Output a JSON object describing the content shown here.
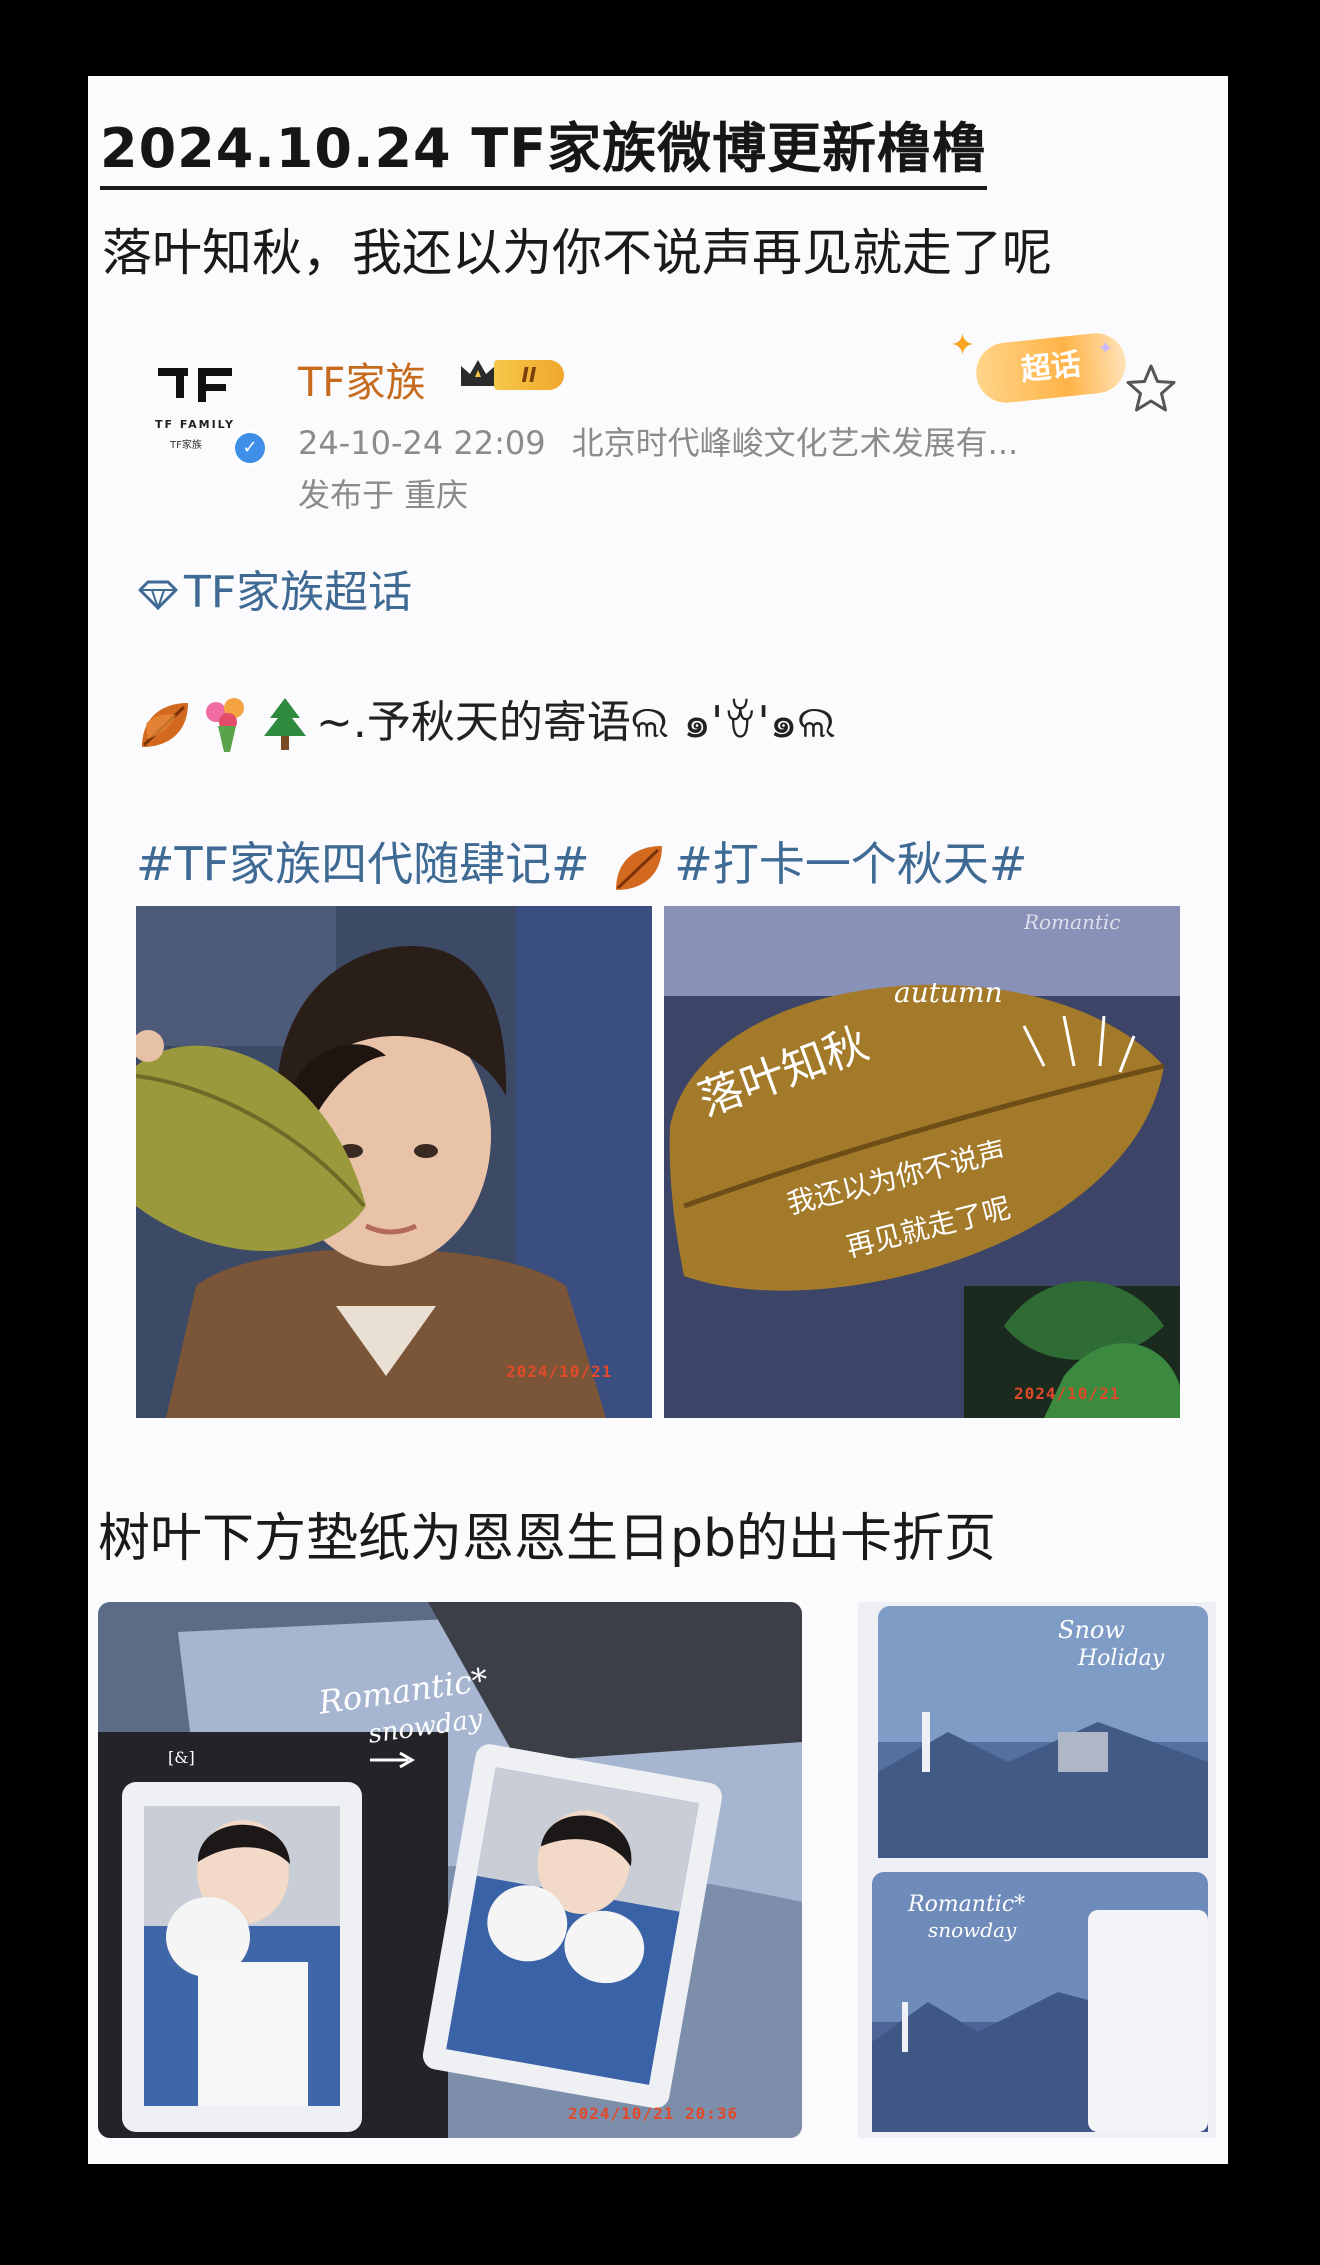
{
  "header": {
    "title": "2024.10.24  TF家族微博更新橹橹",
    "subtitle": "落叶知秋，我还以为你不说声再见就走了呢"
  },
  "post": {
    "logo_text": "TF FAMILY",
    "logo_subtext": "TF家族",
    "username": "TF家族",
    "level": "II",
    "timestamp": "24-10-24 22:09",
    "source": "北京时代峰峻文化艺术发展有...",
    "location": "发布于 重庆",
    "supertopic_badge": "超话",
    "topic_link": "TF家族超话",
    "body_text": "~.予秋天的寄语ଲ ๑'ꈊ'๑ଲ",
    "hashtag_1": "#TF家族四代随肆记#",
    "hashtag_2": "#打卡一个秋天#"
  },
  "photos": {
    "photo1_stamp": "2024/10/21",
    "photo2_stamp": "2024/10/21",
    "photo2_leaf_text_1": "落叶知秋",
    "photo2_leaf_text_2": "我还以为你不说声",
    "photo2_leaf_text_3": "再见就走了呢",
    "photo2_logo": "autumn",
    "photo2_corner": "Romantic"
  },
  "section2": {
    "caption": "树叶下方垫纸为恩恩生日pb的出卡折页",
    "photo3_stamp": "2024/10/21   20:36",
    "photo3_text_1": "Romantic*",
    "photo3_text_2": "snowday",
    "photo3_tag": "[&]",
    "photo4_text_1": "Snow",
    "photo4_text_2": "Holiday",
    "photo4_text_3": "Romantic*",
    "photo4_text_4": "snowday"
  },
  "colors": {
    "username": "#c66a1e",
    "link": "#3e6a94",
    "meta": "#8b8b8b"
  }
}
